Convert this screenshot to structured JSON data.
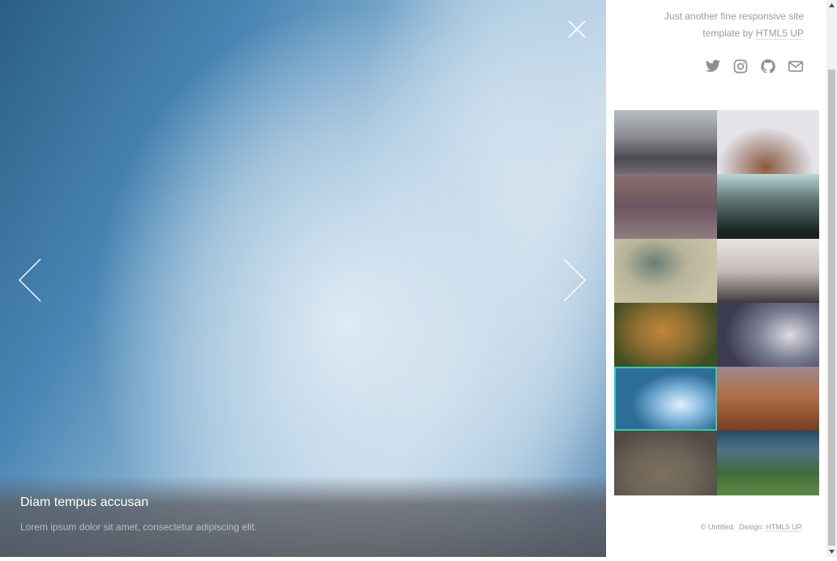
{
  "viewer": {
    "caption_title": "Diam tempus accusan",
    "caption_text": "Lorem ipsum dolor sit amet, consectetur adipiscing elit.",
    "close_icon": "close-icon",
    "prev_icon": "chevron-left-icon",
    "next_icon": "chevron-right-icon"
  },
  "sidebar": {
    "tagline_prefix": "Just another fine responsive site template by",
    "tagline_link": "HTML5 UP",
    "social": [
      "twitter-icon",
      "instagram-icon",
      "github-icon",
      "envelope-icon"
    ],
    "thumbnails_count": 12,
    "active_thumbnail": 9,
    "footer_prefix": "© Untitled.",
    "footer_design_label": "Design:",
    "footer_link": "HTML5 UP",
    "footer_suffix": "."
  },
  "colors": {
    "accent": "#35c9b0",
    "sidebar_text": "#9b9b9b"
  }
}
